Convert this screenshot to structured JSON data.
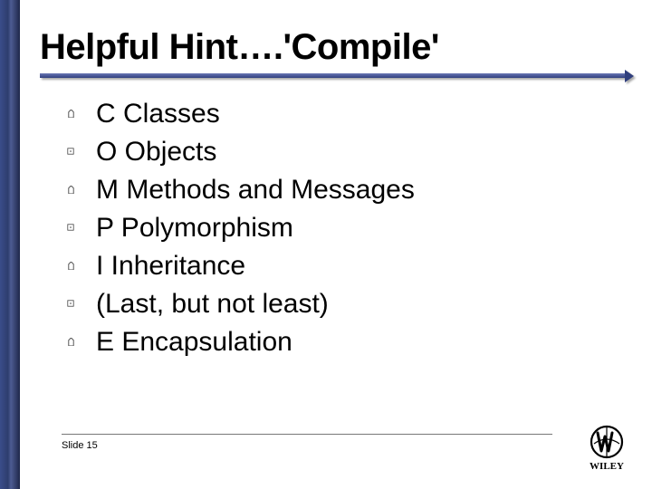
{
  "title": "Helpful Hint….'Compile'",
  "items": [
    "C Classes",
    "O Objects",
    "M Methods and Messages",
    "P Polymorphism",
    "I Inheritance",
    "(Last, but not least)",
    "E Encapsulation"
  ],
  "slide_label": "Slide 15",
  "logo_alt": "WILEY"
}
